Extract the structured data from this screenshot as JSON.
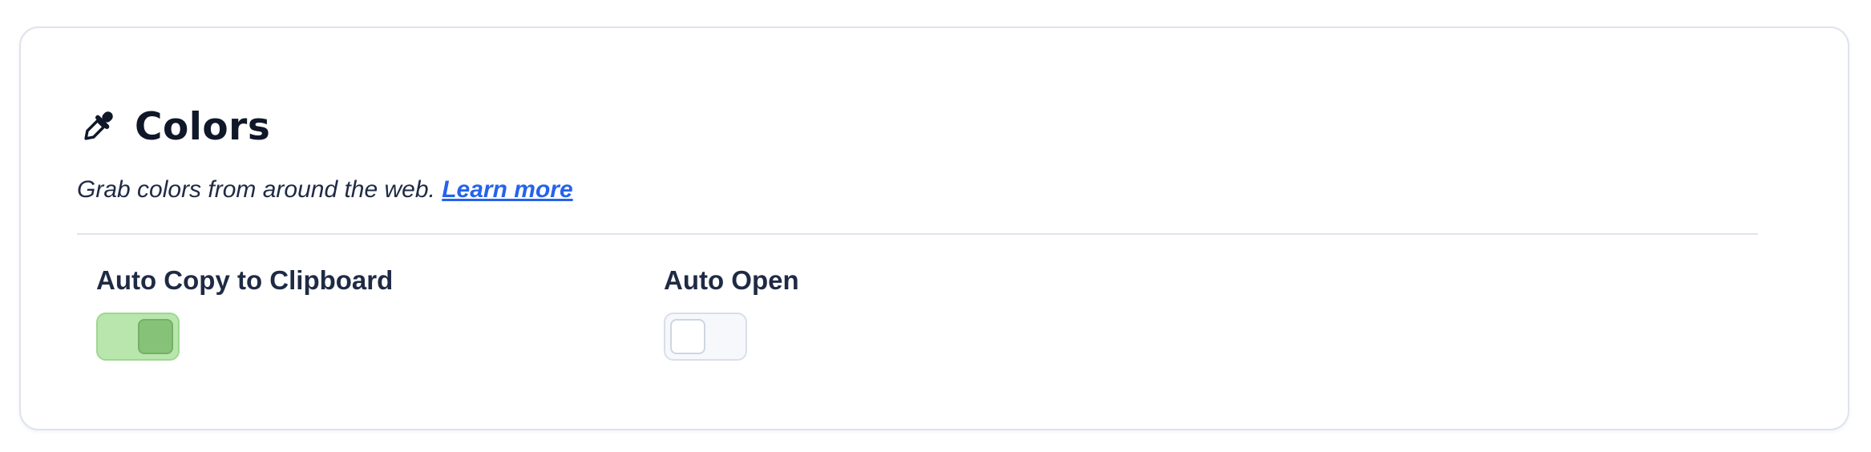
{
  "section": {
    "title": "Colors",
    "icon": "eyedropper-icon",
    "description": "Grab colors from around the web.",
    "link_label": "Learn more"
  },
  "settings": [
    {
      "label": "Auto Copy to Clipboard",
      "enabled": true
    },
    {
      "label": "Auto Open",
      "enabled": false
    }
  ],
  "colors": {
    "toggle_on_track": "#b9e6ad",
    "toggle_on_knob": "#86c278",
    "link": "#2563eb"
  }
}
